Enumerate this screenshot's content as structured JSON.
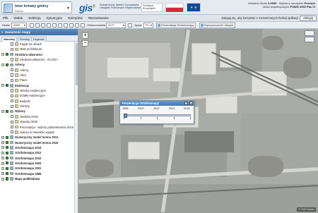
{
  "header": {
    "theme_title": "Inne tematy gminy",
    "theme_sub": "Gmina",
    "logo_gis": "gis",
    "logo_gis_sup": "®",
    "logo_text": "Zintegrowany System Zarządzania Usługami Publicznymi Województwa",
    "eu_logo_text": "Fundusze Europejskie",
    "eu_flag": "★ ★",
    "scale_info_label": "Aktualna Skala",
    "scale_info_value": "1:2000",
    "system_label": "Układ współrzędnych",
    "system_value": "PUWG 2000 Pas VI",
    "mode_label": "Wybrano narzędzie",
    "mode_value": "Przesuń"
  },
  "menubar": {
    "items": [
      "Plik",
      "Widok",
      "Selekcja",
      "Sytuacyjne",
      "Narzędzia",
      "Wyszukiwanie"
    ],
    "login_note": "Zaloguj się, aby korzystać z rozszerzonych funkcji aplikacji",
    "login_button": "Zaloguj"
  },
  "toolbar": {
    "scale_label": "Skala:",
    "scale_value": "2000",
    "coord_label": "Odwzorowanie:",
    "coord_value": "2177",
    "lang_label": "Język:",
    "lang_value": "PL",
    "ortho_button": "Prezentacja Ortofotomapy",
    "clear_button": "Wyczyszczenie danych"
  },
  "panel": {
    "title": "Zawartość mapy",
    "tabs": [
      "Warstwy",
      "Serwisy",
      "Legenda"
    ],
    "active_tab": "Warstwy",
    "rows": [
      {
        "label": "Kręgle na ulicach",
        "group": false,
        "level": 1,
        "on": false
      },
      {
        "label": "Małe architektura",
        "group": false,
        "level": 1,
        "on": false
      },
      {
        "label": "Struktura własności",
        "group": true,
        "level": 0,
        "on": true
      },
      {
        "label": "Struktura własności - 03 2017",
        "group": false,
        "level": 1,
        "on": false
      },
      {
        "label": "Adresy",
        "group": true,
        "level": 0,
        "on": true
      },
      {
        "label": "Adresy",
        "group": false,
        "level": 1,
        "on": false
      },
      {
        "label": "Ulice",
        "group": false,
        "level": 1,
        "on": false
      },
      {
        "label": "Place",
        "group": false,
        "level": 1,
        "on": false
      },
      {
        "label": "Ewidencja",
        "group": true,
        "level": 0,
        "on": true
      },
      {
        "label": "Obręby ewidencyjne",
        "group": false,
        "level": 1,
        "on": false
      },
      {
        "label": "Działki ewidencyjne",
        "group": false,
        "level": 1,
        "on": false
      },
      {
        "label": "Budynki",
        "group": false,
        "level": 1,
        "on": false
      },
      {
        "label": "Ośminy",
        "group": false,
        "level": 1,
        "on": false
      },
      {
        "label": "Wybory",
        "group": true,
        "level": 0,
        "on": true
      },
      {
        "label": "siedziba OKW",
        "group": false,
        "level": 1,
        "on": false
      },
      {
        "label": "obwody OKW",
        "group": false,
        "level": 1,
        "on": false
      },
      {
        "label": "Prezentacja - wybory parlamentarne 2015",
        "group": false,
        "level": 1,
        "on": false
      },
      {
        "label": "wybory w obwodzie wygrał:",
        "group": false,
        "level": 1,
        "on": false
      },
      {
        "label": "Numeryczny model terenu 2012",
        "group": true,
        "level": 0,
        "on": true
      },
      {
        "label": "Numeryczny model terenu 2010",
        "group": true,
        "level": 0,
        "on": true
      },
      {
        "label": "Ortofotomapa 2015",
        "group": true,
        "level": 0,
        "on": true
      },
      {
        "label": "Ortofotomapa 2012",
        "group": true,
        "level": 0,
        "on": true
      },
      {
        "label": "Ortofotomapa 2010",
        "group": true,
        "level": 0,
        "on": true
      },
      {
        "label": "Ortofotomapa 2003",
        "group": true,
        "level": 0,
        "on": true
      },
      {
        "label": "Ortofotomapa 2001",
        "group": true,
        "level": 0,
        "on": true
      },
      {
        "label": "Ortofotomapa 1996",
        "group": true,
        "level": 0,
        "on": true
      },
      {
        "label": "Mapa podkładowa",
        "group": true,
        "level": 0,
        "on": true
      }
    ]
  },
  "dialog": {
    "title": "Prezentacja Ortofotomapy",
    "years": [
      "1996",
      "2003",
      "2010",
      "2012",
      "2015"
    ],
    "help": "?",
    "close": "x",
    "selected_year": "1996"
  },
  "map": {
    "zoom_in": "+",
    "zoom_out": "−",
    "scale_badge": "© GIS Partner"
  },
  "colors": {
    "accent": "#3d6fa5",
    "checked": "#3a8b2e",
    "header_bg": "#e4eaef"
  }
}
